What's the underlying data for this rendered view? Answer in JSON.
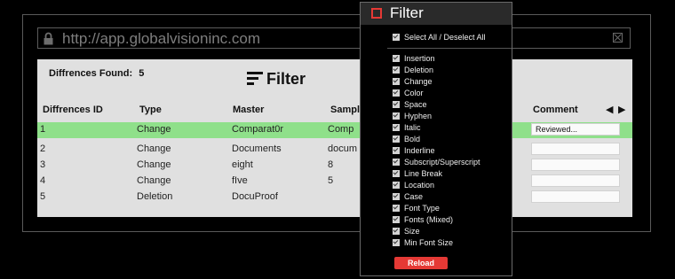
{
  "url_bar": {
    "url": "http://app.globalvisioninc.com"
  },
  "summary": {
    "label": "Diffrences  Found:",
    "count": "5"
  },
  "background_filter": {
    "label": "Filter"
  },
  "table": {
    "columns": [
      "Diffrences ID",
      "Type",
      "Master",
      "Sample",
      "Comment"
    ],
    "nav_arrows": "◀ ▶",
    "rows": [
      {
        "id": "1",
        "type": "Change",
        "master": "Comparat0r",
        "sample": "Comp",
        "comment": "Reviewed...",
        "selected": true
      },
      {
        "id": "2",
        "type": "Change",
        "master": "Documents",
        "sample": "docum",
        "comment": "",
        "selected": false
      },
      {
        "id": "3",
        "type": "Change",
        "master": "eight",
        "sample": "8",
        "comment": "",
        "selected": false
      },
      {
        "id": "4",
        "type": "Change",
        "master": "fIve",
        "sample": "5",
        "comment": "",
        "selected": false
      },
      {
        "id": "5",
        "type": "Deletion",
        "master": "DocuProof",
        "sample": "",
        "comment": "",
        "selected": false
      }
    ]
  },
  "filter_popup": {
    "title": "Filter",
    "select_all": "Select All / Deselect All",
    "options": [
      "Insertion",
      "Deletion",
      "Change",
      "Color",
      "Space",
      "Hyphen",
      "Italic",
      "Bold",
      "Inderline",
      "Subscript/Superscript",
      "Line Break",
      "Location",
      "Case",
      "Font Type",
      "Fonts (Mixed)",
      "Size",
      "Min Font Size"
    ],
    "reload_label": "Reload",
    "accent_color": "#e53935"
  },
  "colors": {
    "selected_row": "#8fe08a",
    "panel": "#e0e0e0",
    "background": "#000000"
  }
}
